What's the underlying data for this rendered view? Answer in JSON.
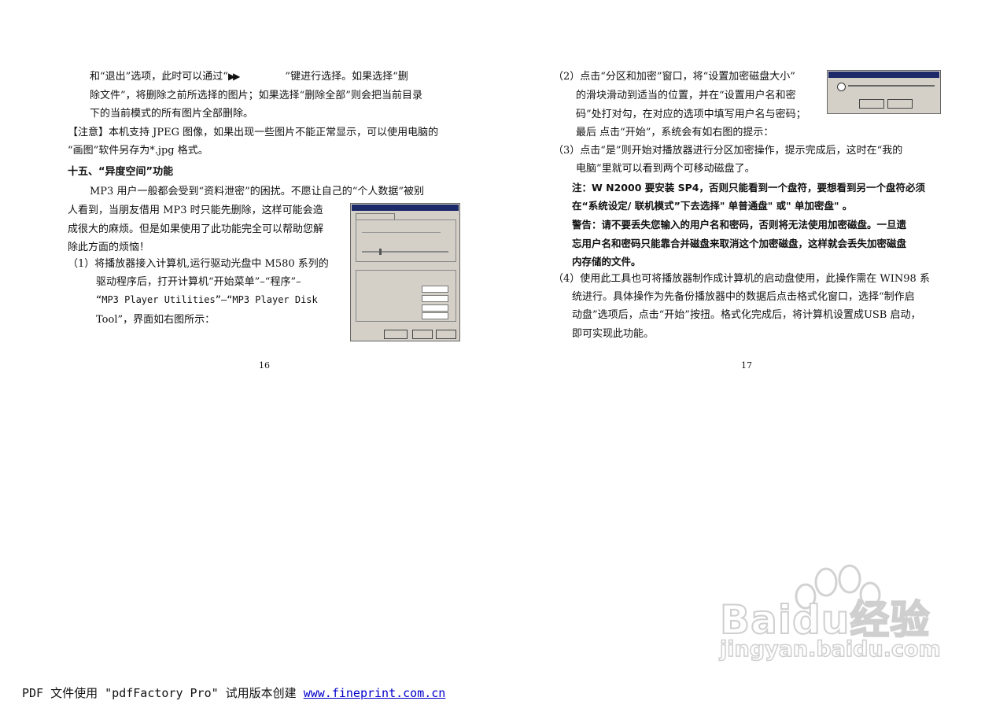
{
  "left_page": {
    "line1a": "和“退出”选项，此时可以通过“",
    "line1b": "”键进行选择。如果选择“删",
    "line2": "除文件”，将删除之前所选择的图片；如果选择“删除全部”则会把当前目录",
    "line3": "下的当前模式的所有图片全部删除。",
    "note1": "【注意】本机支持 JPEG 图像，如果出现一些图片不能正常显示，可以使用电脑的",
    "note2": "“画图”软件另存为*.jpg 格式。",
    "heading": "十五、“异度空间”功能",
    "para1": "MP3 用户一般都会受到“资料泄密”的困扰。不愿让自己的“个人数据”被别",
    "para2": "人看到，当朋友借用 MP3 时只能先删除，这样可能会造",
    "para3": "成很大的麻烦。但是如果使用了此功能完全可以帮助您解",
    "para4": "除此方面的烦恼！",
    "step1a": "（1）将播放器接入计算机,运行驱动光盘中 M580 系列的",
    "step1b": "驱动程序后，打开计算机“开始菜单”–“程序”–",
    "step1c": "“MP3 Player Utilities”–“MP3 Player Disk",
    "step1d": "Tool”，界面如右图所示：",
    "page_number": "16"
  },
  "right_page": {
    "step2a": "（2）点击“分区和加密”窗口，将“设置加密磁盘大小”",
    "step2b": "的滑块滑动到适当的位置，并在“设置用户名和密",
    "step2c": "码”处打对勾，在对应的选项中填写用户名与密码；",
    "step2d": "最后 点击“开始”，系统会有如右图的提示：",
    "step3a": "（3）点击“是”则开始对播放器进行分区加密操作，提示完成后，这时在“我的",
    "step3b": "电脑”里就可以看到两个可移动磁盘了。",
    "note_a": "注：W N2000 要安装 SP4，否则只能看到一个盘符，要想看到另一个盘符必须",
    "note_b": "在“系统设定/ 联机模式”下去选择\" 单普通盘\" 或\" 单加密盘\" 。",
    "warn_a": "警告：请不要丢失您输入的用户名和密码，否则将无法使用加密磁盘。一旦遗",
    "warn_b": "忘用户名和密码只能靠合并磁盘来取消这个加密磁盘，这样就会丢失加密磁盘",
    "warn_c": "内存储的文件。",
    "step4a": "（4）使用此工具也可将播放器制作成计算机的启动盘使用，此操作需在 WIN98 系",
    "step4b": "统进行。具体操作为先备份播放器中的数据后点击格式化窗口，选择“制作启",
    "step4c": "动盘”选项后，点击“开始”按扭。格式化完成后，将计算机设置成USB 启动，",
    "step4d": "即可实现此功能。",
    "page_number": "17"
  },
  "watermark": {
    "brand": "Baidu经验",
    "url": "jingyan.baidu.com"
  },
  "footer": {
    "text": "PDF 文件使用 \"pdfFactory Pro\" 试用版本创建 ",
    "link": "www.fineprint.com.cn"
  }
}
